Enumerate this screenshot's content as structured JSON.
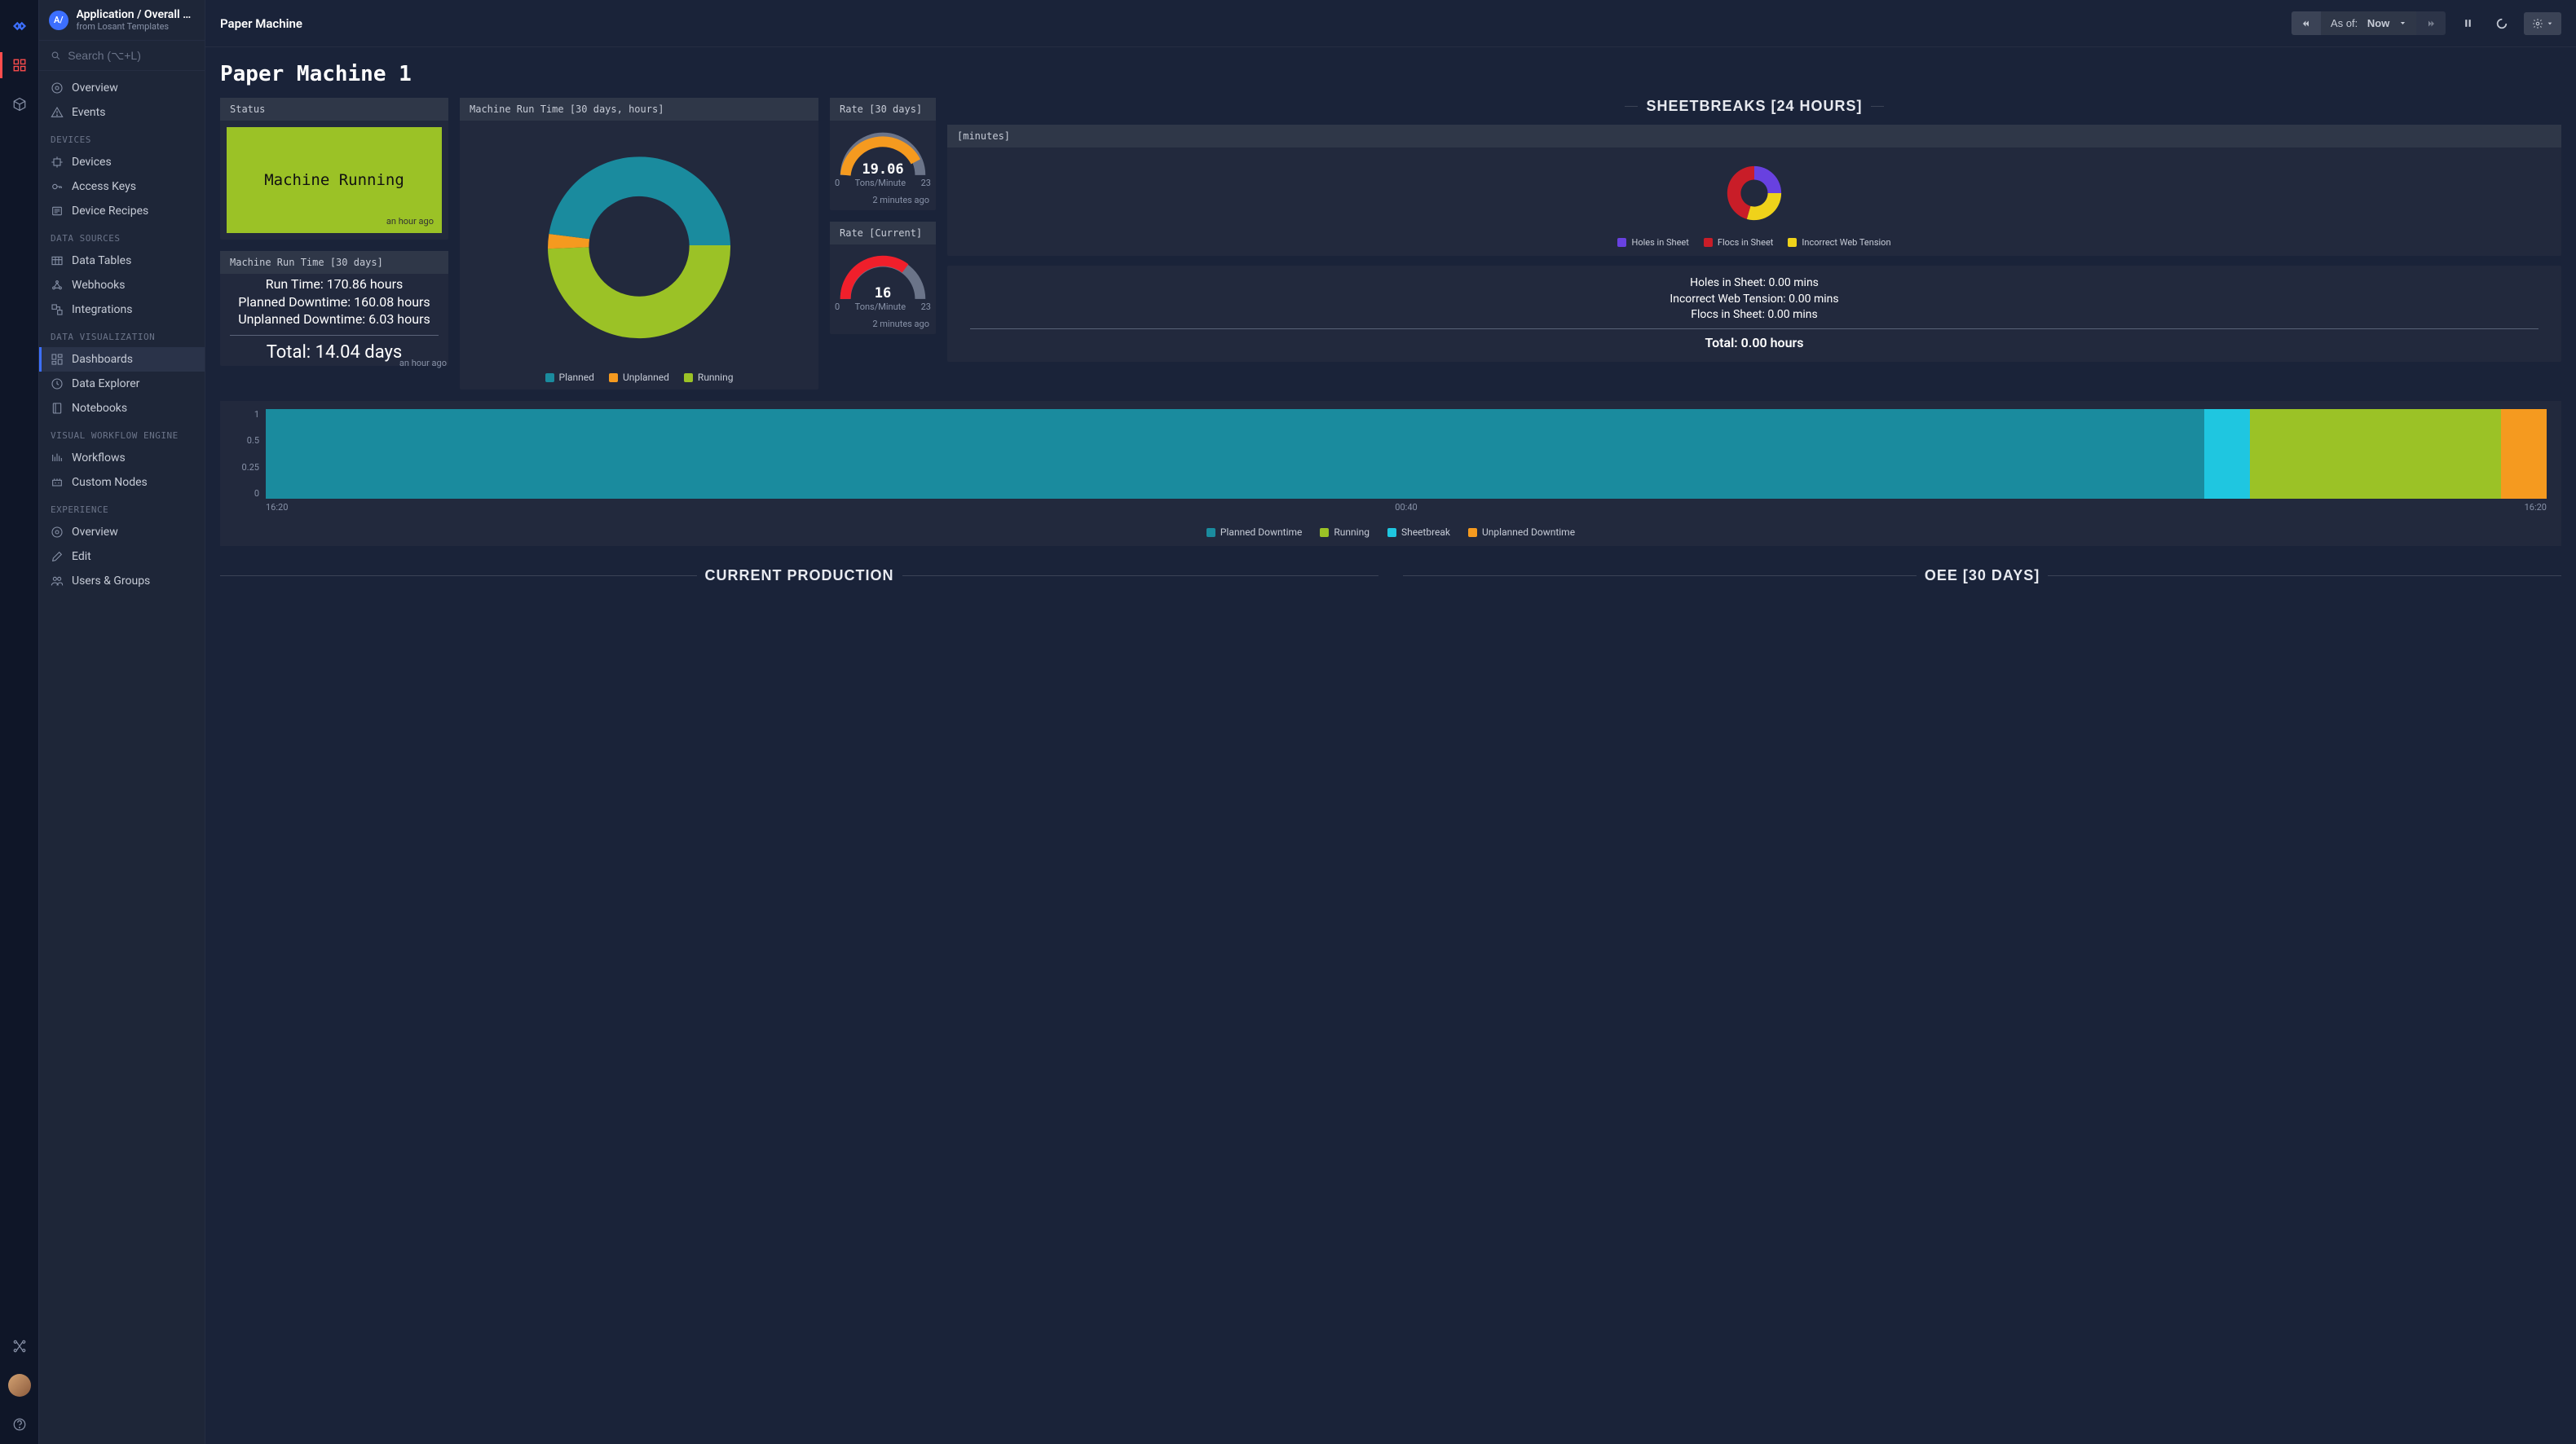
{
  "header": {
    "breadcrumb": "Application / Overall E…",
    "subtitle": "from Losant Templates",
    "badge": "A/",
    "topbar_title": "Paper Machine",
    "asof_prefix": "As of:",
    "asof_value": "Now"
  },
  "search": {
    "placeholder": "Search (⌥+L)"
  },
  "nav": {
    "top": [
      "Overview",
      "Events"
    ],
    "sections": [
      {
        "title": "DEVICES",
        "items": [
          "Devices",
          "Access Keys",
          "Device Recipes"
        ]
      },
      {
        "title": "DATA SOURCES",
        "items": [
          "Data Tables",
          "Webhooks",
          "Integrations"
        ]
      },
      {
        "title": "DATA VISUALIZATION",
        "items": [
          "Dashboards",
          "Data Explorer",
          "Notebooks"
        ],
        "active": "Dashboards"
      },
      {
        "title": "VISUAL WORKFLOW ENGINE",
        "items": [
          "Workflows",
          "Custom Nodes"
        ]
      },
      {
        "title": "EXPERIENCE",
        "items": [
          "Overview",
          "Edit",
          "Users & Groups"
        ]
      }
    ]
  },
  "page": {
    "title": "Paper Machine 1"
  },
  "status": {
    "header": "Status",
    "text": "Machine Running",
    "note": "an hour ago",
    "color": "#9bc226"
  },
  "run_stats": {
    "header": "Machine Run Time [30 days]",
    "run_time": "Run Time: 170.86 hours",
    "planned": "Planned Downtime: 160.08 hours",
    "unplanned": "Unplanned Downtime: 6.03 hours",
    "total": "Total: 14.04 days",
    "note": "an hour ago"
  },
  "donut_chart": {
    "header": "Machine Run Time [30 days, hours]",
    "legend": [
      "Planned",
      "Unplanned",
      "Running"
    ]
  },
  "chart_data": [
    {
      "type": "pie",
      "title": "Machine Run Time [30 days, hours]",
      "series": [
        {
          "name": "Planned",
          "value": 160.08,
          "color": "#1a8b9e"
        },
        {
          "name": "Unplanned",
          "value": 6.03,
          "color": "#f59a1f"
        },
        {
          "name": "Running",
          "value": 170.86,
          "color": "#9bc226"
        }
      ]
    },
    {
      "type": "gauge",
      "title": "Rate [30 days]",
      "value": 19.06,
      "unit": "Tons/Minute",
      "range": [
        0,
        23
      ],
      "color": "#f59a1f"
    },
    {
      "type": "gauge",
      "title": "Rate [Current]",
      "value": 16,
      "unit": "Tons/Minute",
      "range": [
        0,
        23
      ],
      "color": "#f01f2b"
    },
    {
      "type": "pie",
      "title": "Sheetbreaks [24 hours] (minutes)",
      "series": [
        {
          "name": "Holes in Sheet",
          "value": 25,
          "color": "#6841e0"
        },
        {
          "name": "Flocs in Sheet",
          "value": 25,
          "color": "#c91d28"
        },
        {
          "name": "Incorrect Web Tension",
          "value": 25,
          "color": "#efd21a"
        }
      ]
    },
    {
      "type": "timeline",
      "title": "State over 24h",
      "x_ticks": [
        "16:20",
        "00:40",
        "16:20"
      ],
      "y_ticks": [
        0,
        0.25,
        0.5,
        1
      ],
      "legend": [
        "Planned Downtime",
        "Running",
        "Sheetbreak",
        "Unplanned Downtime"
      ],
      "segments": [
        {
          "state": "Planned Downtime",
          "color": "#1a8b9e",
          "width_pct": 85
        },
        {
          "state": "Sheetbreak",
          "color": "#1fc6e0",
          "width_pct": 2
        },
        {
          "state": "Running",
          "color": "#9bc226",
          "width_pct": 11
        },
        {
          "state": "Unplanned Downtime",
          "color": "#f59a1f",
          "width_pct": 2
        }
      ]
    }
  ],
  "gauge_30": {
    "header": "Rate [30 days]",
    "value": "19.06",
    "min": "0",
    "max": "23",
    "unit": "Tons/Minute",
    "note": "2 minutes ago"
  },
  "gauge_cur": {
    "header": "Rate [Current]",
    "value": "16",
    "min": "0",
    "max": "23",
    "unit": "Tons/Minute",
    "note": "2 minutes ago"
  },
  "sheetbreaks": {
    "heading": "SHEETBREAKS [24 HOURS]",
    "panel_header": "[minutes]",
    "legend": [
      "Holes in Sheet",
      "Flocs in Sheet",
      "Incorrect Web Tension"
    ],
    "stats": {
      "l1": "Holes in Sheet: 0.00 mins",
      "l2": "Incorrect Web Tension: 0.00 mins",
      "l3": "Flocs in Sheet: 0.00 mins",
      "total": "Total: 0.00 hours"
    }
  },
  "timeline": {
    "y": [
      "1",
      "0.5",
      "0.25",
      "0"
    ],
    "x": [
      "16:20",
      "00:40",
      "16:20"
    ],
    "legend": [
      "Planned Downtime",
      "Running",
      "Sheetbreak",
      "Unplanned Downtime"
    ]
  },
  "bottom_headings": {
    "left": "CURRENT PRODUCTION",
    "right": "OEE [30 DAYS]"
  },
  "colors": {
    "teal": "#1a8b9e",
    "orange": "#f59a1f",
    "lime": "#9bc226",
    "red": "#f01f2b",
    "purple": "#6841e0",
    "crimson": "#c91d28",
    "yellow": "#efd21a",
    "cyan": "#1fc6e0",
    "gray": "#6b7489"
  }
}
